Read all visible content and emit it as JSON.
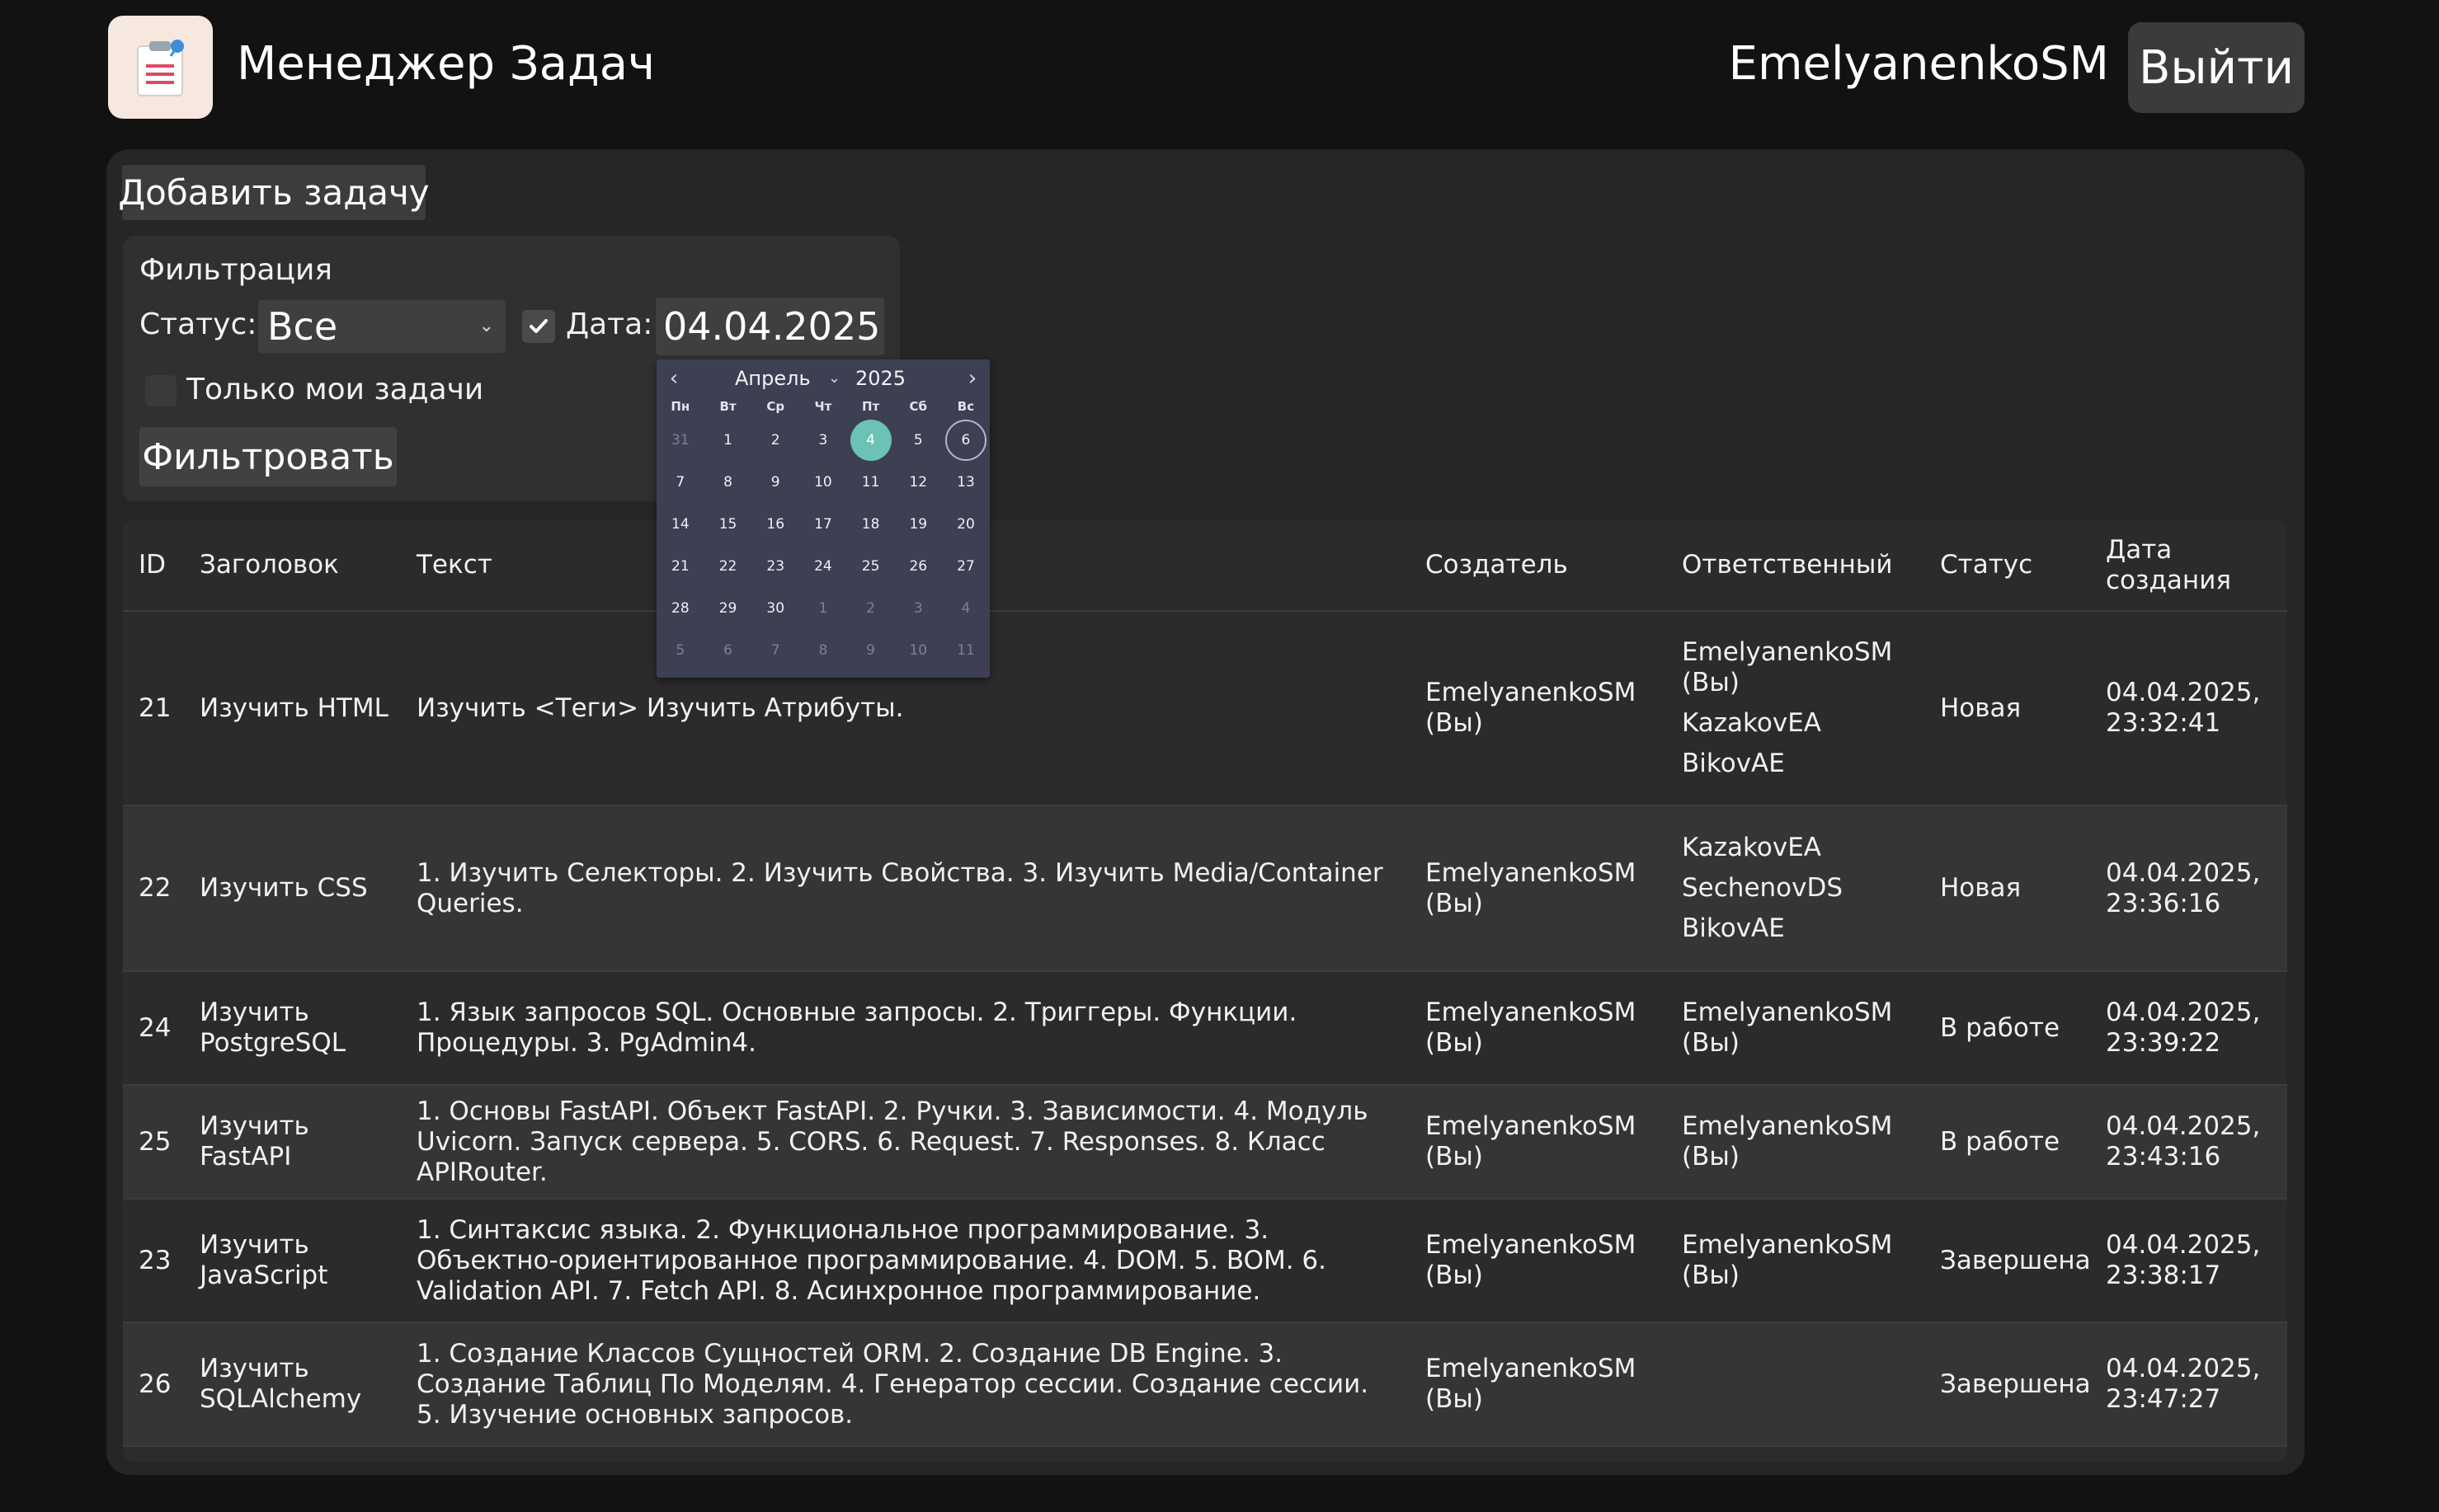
{
  "header": {
    "app_title": "Менеджер Задач",
    "user_name": "EmelyanenkoSM",
    "logout_label": "Выйти"
  },
  "toolbar": {
    "add_task_label": "Добавить задачу"
  },
  "filter": {
    "title": "Фильтрация",
    "status_label": "Статус:",
    "status_value": "Все",
    "date_checked": true,
    "date_label": "Дата:",
    "date_value": "04.04.2025",
    "only_mine_label": "Только мои задачи",
    "only_mine_checked": false,
    "apply_label": "Фильтровать"
  },
  "calendar": {
    "month": "Апрель",
    "year": "2025",
    "weekdays": [
      "Пн",
      "Вт",
      "Ср",
      "Чт",
      "Пт",
      "Сб",
      "Вс"
    ],
    "weeks": [
      [
        "31",
        "1",
        "2",
        "3",
        "4",
        "5",
        "6"
      ],
      [
        "7",
        "8",
        "9",
        "10",
        "11",
        "12",
        "13"
      ],
      [
        "14",
        "15",
        "16",
        "17",
        "18",
        "19",
        "20"
      ],
      [
        "21",
        "22",
        "23",
        "24",
        "25",
        "26",
        "27"
      ],
      [
        "28",
        "29",
        "30",
        "1",
        "2",
        "3",
        "4"
      ],
      [
        "5",
        "6",
        "7",
        "8",
        "9",
        "10",
        "11"
      ]
    ],
    "selected_day": "4",
    "today_day": "6",
    "selected_color": "#6cc2b3"
  },
  "table": {
    "columns": [
      "ID",
      "Заголовок",
      "Текст",
      "Создатель",
      "Ответственный",
      "Статус",
      "Дата создания"
    ],
    "rows": [
      {
        "id": "21",
        "title": "Изучить HTML",
        "text": "Изучить <Теги> Изучить Атрибуты.",
        "creator": "EmelyanenkoSM (Вы)",
        "responsible": [
          "EmelyanenkoSM (Вы)",
          "KazakovEA",
          "BikovAE"
        ],
        "status": "Новая",
        "created": "04.04.2025, 23:32:41"
      },
      {
        "id": "22",
        "title": "Изучить CSS",
        "text": "1. Изучить Селекторы. 2. Изучить Свойства. 3. Изучить Media/Container Queries.",
        "creator": "EmelyanenkoSM (Вы)",
        "responsible": [
          "KazakovEA",
          "SechenovDS",
          "BikovAE"
        ],
        "status": "Новая",
        "created": "04.04.2025, 23:36:16"
      },
      {
        "id": "24",
        "title": "Изучить PostgreSQL",
        "text": "1. Язык запросов SQL. Основные запросы. 2. Триггеры. Функции. Процедуры. 3. PgAdmin4.",
        "creator": "EmelyanenkoSM (Вы)",
        "responsible": [
          "EmelyanenkoSM (Вы)"
        ],
        "status": "В работе",
        "created": "04.04.2025, 23:39:22"
      },
      {
        "id": "25",
        "title": "Изучить FastAPI",
        "text": "1. Основы FastAPI. Объект FastAPI. 2. Ручки. 3. Зависимости. 4. Модуль Uvicorn. Запуск сервера. 5. CORS. 6. Request. 7. Responses. 8. Класс APIRouter.",
        "creator": "EmelyanenkoSM (Вы)",
        "responsible": [
          "EmelyanenkoSM (Вы)"
        ],
        "status": "В работе",
        "created": "04.04.2025, 23:43:16"
      },
      {
        "id": "23",
        "title": "Изучить JavaScript",
        "text": "1. Синтаксис языка. 2. Функциональное программирование. 3. Объектно-ориентированное программирование. 4. DOM. 5. BOM. 6. Validation API. 7. Fetch API. 8. Асинхронное программирование.",
        "creator": "EmelyanenkoSM (Вы)",
        "responsible": [
          "EmelyanenkoSM (Вы)"
        ],
        "status": "Завершена",
        "created": "04.04.2025, 23:38:17"
      },
      {
        "id": "26",
        "title": "Изучить SQLAlchemy",
        "text": "1. Создание Классов Сущностей ORM. 2. Создание DB Engine. 3. Создание Таблиц По Моделям. 4. Генератор сессии. Создание сессии. 5. Изучение основных запросов.",
        "creator": "EmelyanenkoSM (Вы)",
        "responsible": [],
        "status": "Завершена",
        "created": "04.04.2025, 23:47:27"
      }
    ]
  }
}
